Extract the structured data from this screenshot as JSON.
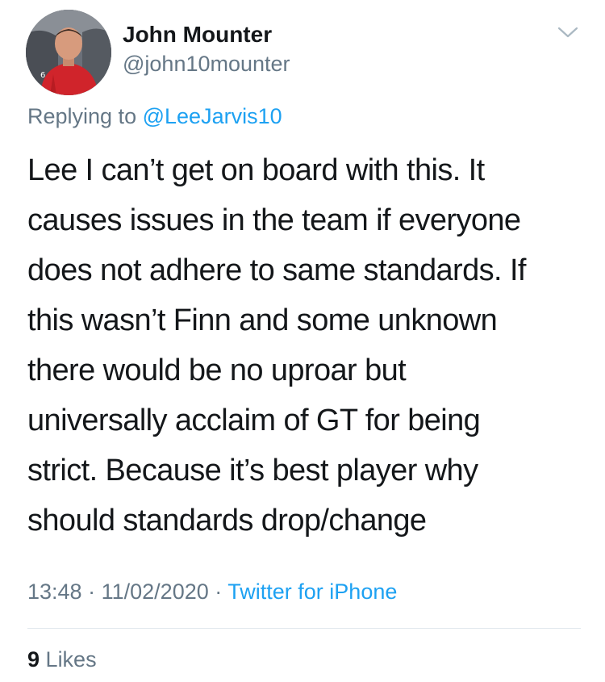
{
  "tweet": {
    "author": {
      "display_name": "John Mounter",
      "handle": "@john10mounter",
      "avatar_icon": "profile-photo"
    },
    "menu_icon": "chevron-down-icon",
    "replying_prefix": "Replying to",
    "replying_to": "@LeeJarvis10",
    "text": "Lee I can’t get on board with this. It\ncauses issues in the team if everyone\ndoes not adhere to same standards. If\nthis wasn’t Finn and some unknown\nthere would be no uproar but\nuniversally acclaim of GT for being\nstrict. Because it’s best player why\nshould standards drop/change",
    "time": "13:48",
    "separator": "·",
    "date": "11/02/2020",
    "source": "Twitter for iPhone",
    "likes_count": "9",
    "likes_label": "Likes"
  },
  "colors": {
    "link": "#1da1f2",
    "secondary_text": "#657786",
    "primary_text": "#14171a",
    "divider": "#e1e8ed"
  }
}
